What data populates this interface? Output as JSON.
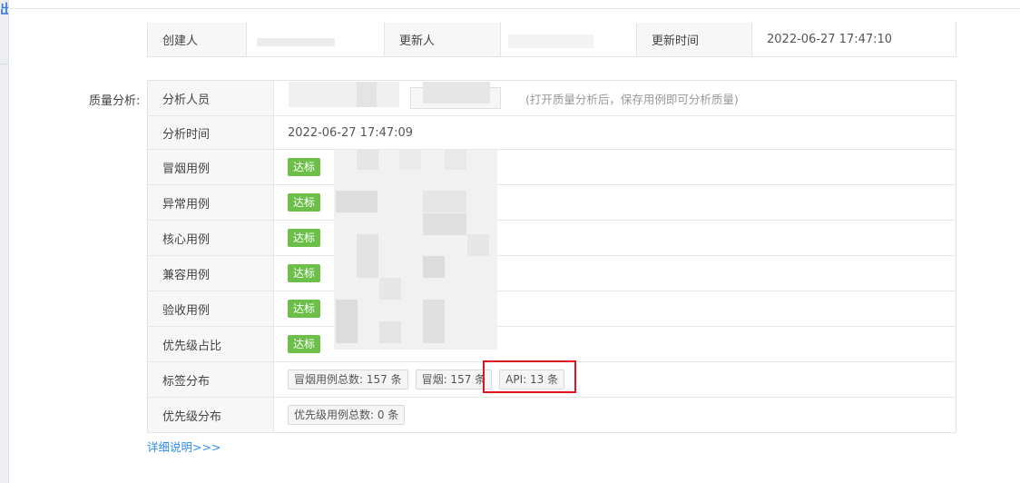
{
  "rail": {
    "glyph": "出"
  },
  "info": {
    "created_by_label": "创建人",
    "updated_by_label": "更新人",
    "updated_time_label": "更新时间",
    "updated_time_value": "2022-06-27 17:47:10"
  },
  "quality": {
    "section_label": "质量分析:",
    "analyst_label": "分析人员",
    "analyst_hint": "(打开质量分析后，保存用例即可分析质量)",
    "analysis_time_label": "分析时间",
    "analysis_time_value": "2022-06-27 17:47:09",
    "status_label": "达标",
    "rows": [
      {
        "label": "冒烟用例"
      },
      {
        "label": "异常用例"
      },
      {
        "label": "核心用例"
      },
      {
        "label": "兼容用例"
      },
      {
        "label": "验收用例"
      },
      {
        "label": "优先级占比"
      }
    ],
    "tag_dist_label": "标签分布",
    "tag_dist_items": [
      "冒烟用例总数: 157 条",
      "冒烟: 157 条",
      "API: 13 条"
    ],
    "priority_dist_label": "优先级分布",
    "priority_dist_items": [
      "优先级用例总数: 0 条"
    ]
  },
  "links": {
    "detail": "详细说明>>>"
  },
  "colors": {
    "pass_green": "#6cc04a",
    "link_blue": "#2d8cf0",
    "highlight_red": "#e0141e"
  }
}
